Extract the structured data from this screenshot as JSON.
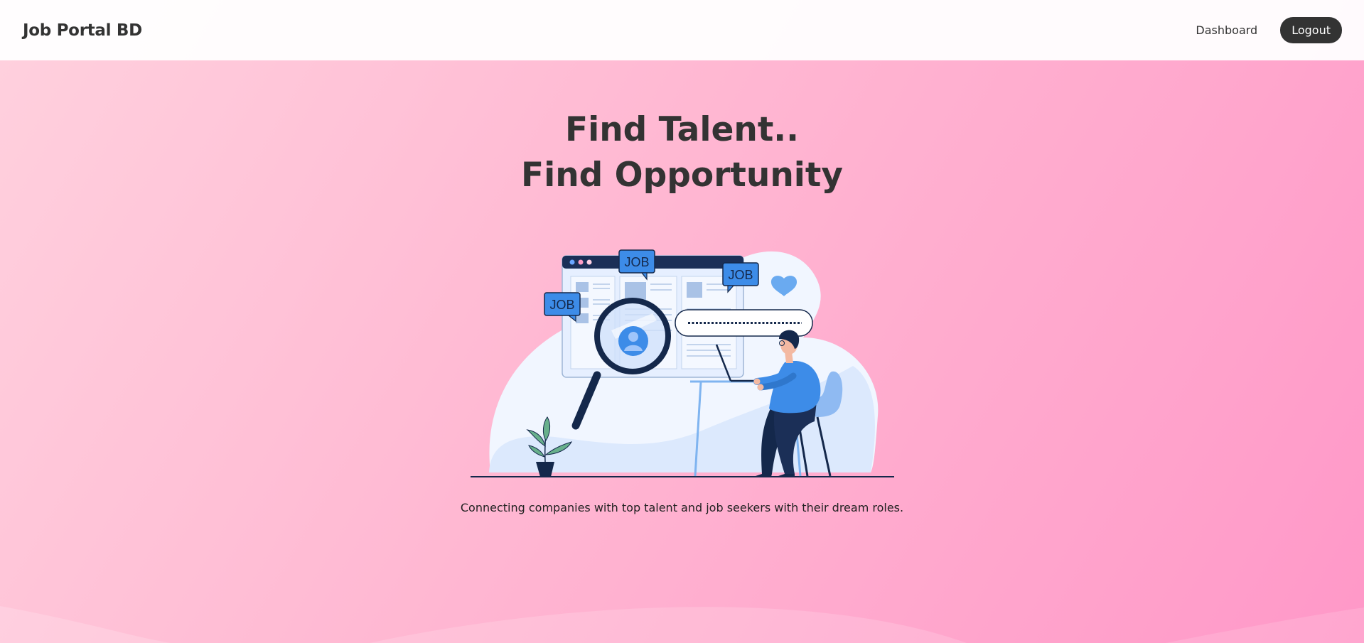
{
  "nav": {
    "brand": "Job Portal BD",
    "dashboard_label": "Dashboard",
    "logout_label": "Logout"
  },
  "hero": {
    "headline_line1": "Find Talent..",
    "headline_line2": "Find Opportunity",
    "tagline": "Connecting companies with top talent and job seekers with their dream roles.",
    "illustration": {
      "job_badge_label": "JOB"
    }
  },
  "colors": {
    "background_start": "#ffd1de",
    "background_end": "#ff98c8",
    "navbar_bg": "#ffffff",
    "dark": "#333333",
    "accent_blue": "#3d8ce8",
    "navy": "#14284b"
  },
  "icons": {
    "illustration": "job-search-illustration",
    "magnifier": "magnifier-icon",
    "heart": "heart-icon",
    "plant": "plant-icon"
  }
}
